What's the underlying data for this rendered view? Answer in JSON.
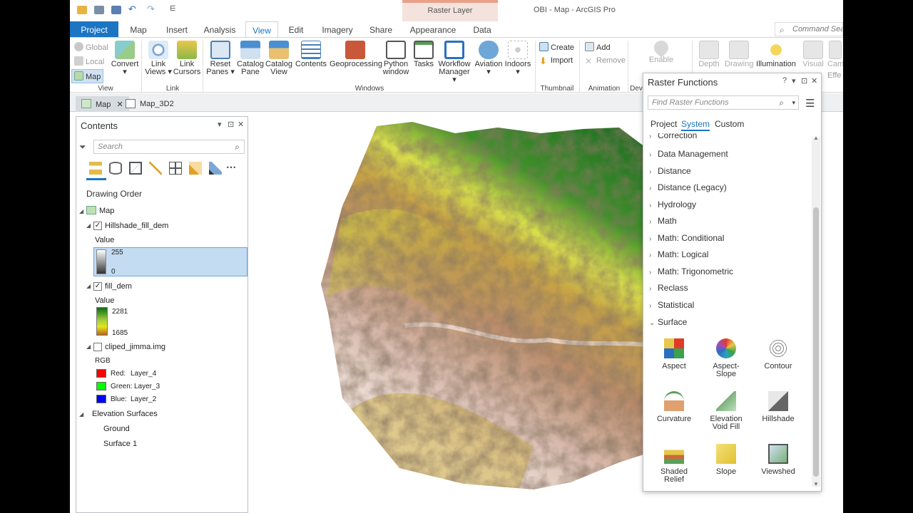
{
  "window": {
    "title": "OBI - Map - ArcGIS Pro",
    "contextual_group": "Raster Layer",
    "command_search_placeholder": "Command Search"
  },
  "tabs": [
    "Project",
    "Map",
    "Insert",
    "Analysis",
    "View",
    "Edit",
    "Imagery",
    "Share",
    "Appearance",
    "Data"
  ],
  "active_tab": "View",
  "ribbon": {
    "view_group": {
      "label": "View",
      "items": [
        "Global",
        "Local",
        "Map"
      ],
      "convert": "Convert"
    },
    "link_group": {
      "label": "Link",
      "items": [
        "Link Views",
        "Link Cursors"
      ]
    },
    "windows_group": {
      "label": "Windows",
      "items": [
        "Reset Panes",
        "Catalog Pane",
        "Catalog View",
        "Contents",
        "Geoprocessing",
        "Python window",
        "Tasks",
        "Workflow Manager",
        "Aviation",
        "Indoors"
      ]
    },
    "thumbnail_group": {
      "label": "Thumbnail",
      "items": [
        "Create",
        "Import"
      ]
    },
    "animation_group": {
      "label": "Animation",
      "items": [
        "Add",
        "Remove"
      ]
    },
    "device_group": {
      "label": "Dev",
      "items": [
        "Enable"
      ]
    },
    "effects": [
      "Depth",
      "Drawing",
      "Illumination",
      "Visual",
      "Cam"
    ],
    "effects_sub": [
      "Effe"
    ]
  },
  "view_tabs": [
    "Map",
    "Map_3D2"
  ],
  "contents": {
    "title": "Contents",
    "search_placeholder": "Search",
    "heading": "Drawing Order",
    "map": "Map",
    "layers": [
      {
        "name": "Hillshade_fill_dem",
        "checked": true,
        "legend_title": "Value",
        "max": "255",
        "min": "0"
      },
      {
        "name": "fill_dem",
        "checked": true,
        "legend_title": "Value",
        "max": "2281",
        "min": "1685"
      },
      {
        "name": "cliped_jimma.img",
        "checked": false,
        "legend_title": "RGB",
        "bands": [
          {
            "label": "Red:",
            "band": "Layer_4",
            "color": "#ff0000"
          },
          {
            "label": "Green:",
            "band": "Layer_3",
            "color": "#00ff00"
          },
          {
            "label": "Blue:",
            "band": "Layer_2",
            "color": "#0000ff"
          }
        ]
      }
    ],
    "elevation_surfaces": "Elevation Surfaces",
    "surfaces": [
      "Ground",
      "Surface 1"
    ]
  },
  "raster_functions": {
    "title": "Raster Functions",
    "search_placeholder": "Find Raster Functions",
    "tabs": [
      "Project",
      "System",
      "Custom"
    ],
    "active_tab": "System",
    "categories": [
      "Correction",
      "Data Management",
      "Distance",
      "Distance (Legacy)",
      "Hydrology",
      "Math",
      "Math: Conditional",
      "Math: Logical",
      "Math: Trigonometric",
      "Reclass",
      "Statistical",
      "Surface"
    ],
    "surface_functions": [
      {
        "name": "Aspect",
        "icon": "aspect-icon"
      },
      {
        "name": "Aspect-Slope",
        "icon": "aspect-slope-icon"
      },
      {
        "name": "Contour",
        "icon": "contour-icon"
      },
      {
        "name": "Curvature",
        "icon": "curvature-icon"
      },
      {
        "name": "Elevation",
        "name2": "Void Fill",
        "icon": "elevation-void-fill-icon"
      },
      {
        "name": "Hillshade",
        "icon": "hillshade-icon"
      },
      {
        "name": "Shaded",
        "name2": "Relief",
        "icon": "shaded-relief-icon"
      },
      {
        "name": "Slope",
        "icon": "slope-icon"
      },
      {
        "name": "Viewshed",
        "icon": "viewshed-icon"
      }
    ]
  },
  "colors": {
    "accent": "#1b75c3",
    "dem_high": "#1d6b1d",
    "dem_mid": "#e6e617",
    "dem_low": "#b5651d"
  }
}
